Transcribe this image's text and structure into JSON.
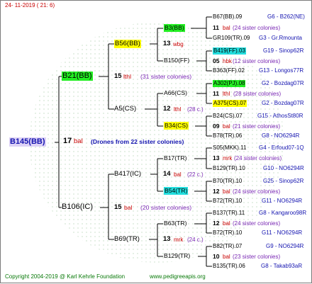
{
  "header": {
    "date": "24- 11-2019 ( 21: 6)"
  },
  "footer": {
    "copyright": "Copyright 2004-2019 @ Karl Kehrle Foundation",
    "site": "www.pedigreeapis.org"
  },
  "root": {
    "id": "B145(BB)",
    "gen": "17",
    "bal": "bal",
    "note": "(Drones from 22 sister colonies)"
  },
  "gen1": [
    {
      "id": "B21(BB)",
      "gen": "15",
      "tag": "lthl",
      "note": "(31 sister colonies)"
    },
    {
      "id": "B106(IC)",
      "gen": "15",
      "tag": "bal",
      "note": "(20 sister colonies)"
    }
  ],
  "gen2": [
    {
      "id": "B56(BB)",
      "gen": "13",
      "tag": "wbg"
    },
    {
      "id": "A5(CS)",
      "gen": "12",
      "tag": "lthl",
      "note": "(28 c.)"
    },
    {
      "id": "B417(IC)",
      "gen": "14",
      "tag": "bal",
      "note": "(22 c.)"
    },
    {
      "id": "B69(TR)",
      "gen": "13",
      "tag": "mrk",
      "note": "(24 c.)"
    }
  ],
  "gen3": [
    {
      "id": "B3(BB)"
    },
    {
      "id": "B150(FF)"
    },
    {
      "id": "A66(CS)"
    },
    {
      "id": "B34(CS)"
    },
    {
      "id": "B17(TR)"
    },
    {
      "id": "B54(TR)"
    },
    {
      "id": "B63(TR)"
    },
    {
      "id": "B129(TR)"
    }
  ],
  "gen4": [
    {
      "id": "B67(BB).09",
      "info": "G6 - B262(NE)"
    },
    {
      "gen": "11",
      "tag": "bal",
      "note": "(24 sister colonies)"
    },
    {
      "id": "GR109(TR).09",
      "info": "G3 - Gr.Rmounta"
    },
    {
      "id": "B419(FF).03",
      "info": "G19 - Sinop62R"
    },
    {
      "gen": "05",
      "tag": "hbk",
      "note": "(12 sister colonies)"
    },
    {
      "id": "B363(FF).02",
      "info": "G13 - Longos77R"
    },
    {
      "id": "A302(PJ).08",
      "info": "G2 - Bozdag07R"
    },
    {
      "gen": "11",
      "tag": "lthl",
      "note": "(28 sister colonies)"
    },
    {
      "id": "A375(CS).07",
      "info": "G2 - Bozdag07R"
    },
    {
      "id": "B24(CS).07",
      "info": "G15 - AthosSt80R"
    },
    {
      "gen": "09",
      "tag": "bal",
      "note": "(21 sister colonies)"
    },
    {
      "id": "B78(TR).06",
      "info": "G8 - NO6294R"
    },
    {
      "id": "S05(MKK).11",
      "info": "G4 - Erfoud07-1Q"
    },
    {
      "gen": "13",
      "tag": "mrk",
      "note": "(24 sister colonies)"
    },
    {
      "id": "B129(TR).10",
      "info": "G10 - NO6294R"
    },
    {
      "id": "B70(TR).10",
      "info": "G25 - Sinop62R"
    },
    {
      "gen": "12",
      "tag": "bal",
      "note": "(24 sister colonies)"
    },
    {
      "id": "B72(TR).10",
      "info": "G11 - NO6294R"
    },
    {
      "id": "B137(TR).11",
      "info": "G8 - Kangaroo98R"
    },
    {
      "gen": "12",
      "tag": "bal",
      "note": "(24 sister colonies)"
    },
    {
      "id": "B72(TR).10",
      "info": "G11 - NO6294R"
    },
    {
      "id": "B82(TR).07",
      "info": "G9 - NO6294R"
    },
    {
      "gen": "10",
      "tag": "bal",
      "note": "(23 sister colonies)"
    },
    {
      "id": "B135(TR).06",
      "info": "G8 - Takab93aR"
    }
  ]
}
